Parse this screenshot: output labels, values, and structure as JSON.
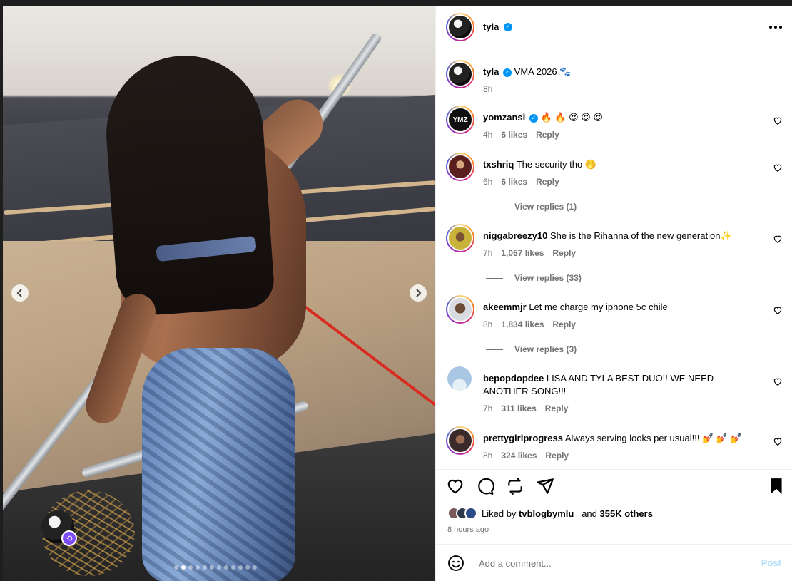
{
  "post": {
    "author": "tyla",
    "caption": "VMA 2026 🐾",
    "caption_time": "8h",
    "more_icon": "more-horizontal-icon"
  },
  "comments": [
    {
      "user": "yomzansi",
      "verified": true,
      "text": "🔥 🔥 😍 😍 😍",
      "time": "4h",
      "likes": "6 likes",
      "reply": "Reply",
      "avatar_color": "#111111"
    },
    {
      "user": "txshriq",
      "verified": false,
      "text": "The security tho 🤭",
      "time": "6h",
      "likes": "6 likes",
      "reply": "Reply",
      "avatar_color": "#5a1e1e",
      "view_replies": "View replies (1)"
    },
    {
      "user": "niggabreezy10",
      "verified": false,
      "text": "She is the Rihanna of the new generation✨",
      "time": "7h",
      "likes": "1,057 likes",
      "reply": "Reply",
      "avatar_color": "#c9b23a",
      "view_replies": "View replies (33)"
    },
    {
      "user": "akeemmjr",
      "verified": false,
      "text": "Let me charge my iphone 5c chile",
      "time": "8h",
      "likes": "1,834 likes",
      "reply": "Reply",
      "avatar_color": "#6b4a36",
      "view_replies": "View replies (3)"
    },
    {
      "user": "bepopdopdee",
      "verified": false,
      "text": "LISA AND TYLA BEST DUO!! WE NEED ANOTHER SONG!!!",
      "time": "7h",
      "likes": "311 likes",
      "reply": "Reply",
      "avatar_color": "#a9c7e4"
    },
    {
      "user": "prettygirlprogress",
      "verified": false,
      "text": "Always serving looks per usual!!! 💅 💅 💅",
      "time": "8h",
      "likes": "324 likes",
      "reply": "Reply",
      "avatar_color": "#3b2a2a"
    }
  ],
  "likes": {
    "prefix": "Liked by",
    "user": "tvblogbymlu_",
    "joiner": "and",
    "others": "355K others"
  },
  "post_time": "8 hours ago",
  "add_comment": {
    "placeholder": "Add a comment...",
    "post_label": "Post"
  },
  "carousel": {
    "slide_count": 12,
    "active_slide": 2
  },
  "colors": {
    "verified": "#0095f6",
    "post_disabled": "#b2dffc",
    "muted": "#737373"
  }
}
